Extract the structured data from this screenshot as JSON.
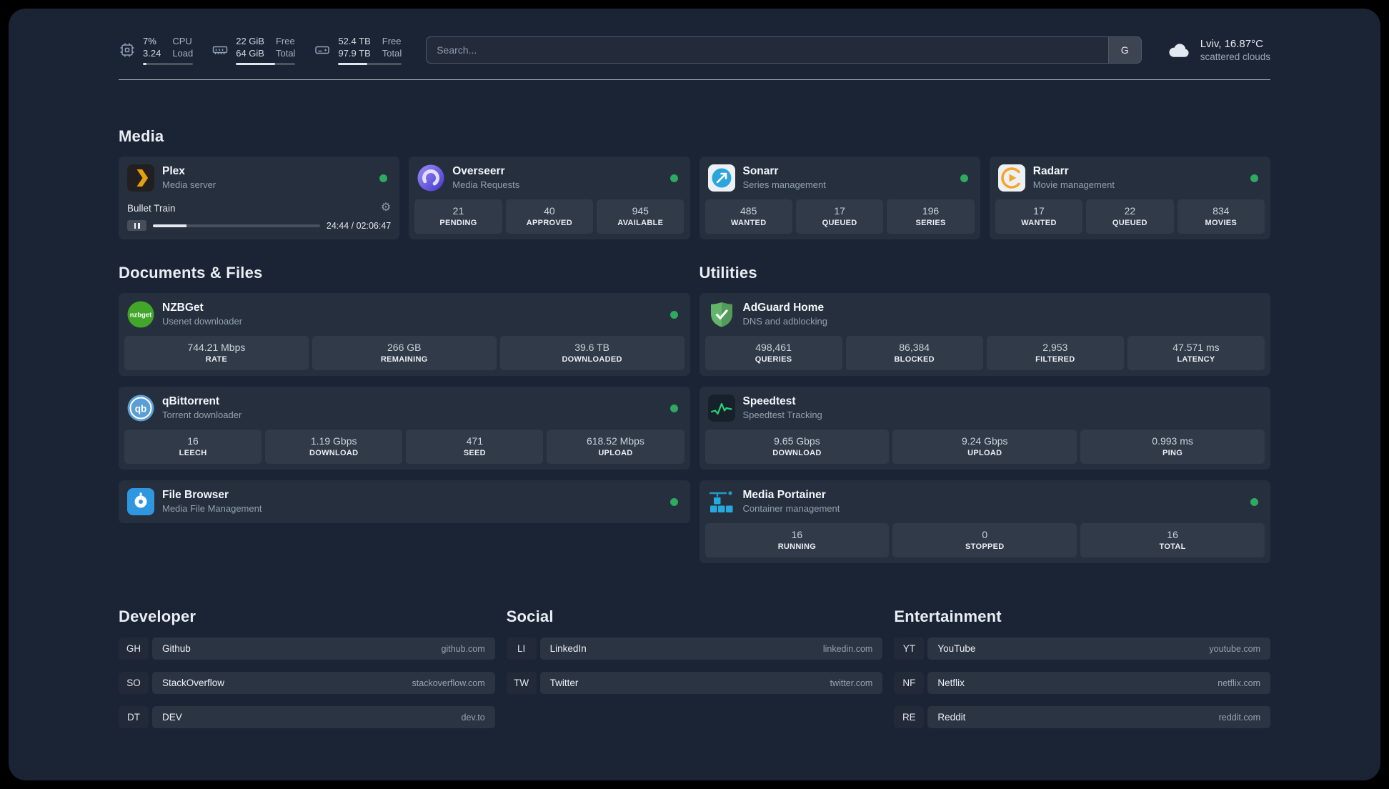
{
  "colors": {
    "background": "#1b2434",
    "status_online": "#2ea95f",
    "plex_accent": "#e5a00d",
    "speedtest_accent": "#2dd36f",
    "progress_fill": "#e2e8f0"
  },
  "topbar": {
    "cpu": {
      "values": [
        "7%",
        "3.24"
      ],
      "labels": [
        "CPU",
        "Load"
      ],
      "used_percent": 7
    },
    "memory": {
      "values": [
        "22 GiB",
        "64 GiB"
      ],
      "labels": [
        "Free",
        "Total"
      ],
      "used_percent": 66
    },
    "disk": {
      "values": [
        "52.4 TB",
        "97.9 TB"
      ],
      "labels": [
        "Free",
        "Total"
      ],
      "used_percent": 46
    },
    "search": {
      "placeholder": "Search...",
      "provider": "G"
    },
    "weather": {
      "location": "Lviv, 16.87°C",
      "condition": "scattered clouds"
    }
  },
  "media": {
    "title": "Media",
    "services": [
      {
        "name": "Plex",
        "description": "Media server",
        "online": true,
        "player": {
          "track": "Bullet Train",
          "time": "24:44 / 02:06:47",
          "progress_percent": 20
        }
      },
      {
        "name": "Overseerr",
        "description": "Media Requests",
        "online": true,
        "stats": [
          {
            "value": "21",
            "label": "PENDING"
          },
          {
            "value": "40",
            "label": "APPROVED"
          },
          {
            "value": "945",
            "label": "AVAILABLE"
          }
        ]
      },
      {
        "name": "Sonarr",
        "description": "Series management",
        "online": true,
        "stats": [
          {
            "value": "485",
            "label": "WANTED"
          },
          {
            "value": "17",
            "label": "QUEUED"
          },
          {
            "value": "196",
            "label": "SERIES"
          }
        ]
      },
      {
        "name": "Radarr",
        "description": "Movie management",
        "online": true,
        "stats": [
          {
            "value": "17",
            "label": "WANTED"
          },
          {
            "value": "22",
            "label": "QUEUED"
          },
          {
            "value": "834",
            "label": "MOVIES"
          }
        ]
      }
    ]
  },
  "documents": {
    "title": "Documents & Files",
    "services": [
      {
        "name": "NZBGet",
        "description": "Usenet downloader",
        "online": true,
        "stats": [
          {
            "value": "744.21 Mbps",
            "label": "RATE"
          },
          {
            "value": "266 GB",
            "label": "REMAINING"
          },
          {
            "value": "39.6 TB",
            "label": "DOWNLOADED"
          }
        ]
      },
      {
        "name": "qBittorrent",
        "description": "Torrent downloader",
        "online": true,
        "stats": [
          {
            "value": "16",
            "label": "LEECH"
          },
          {
            "value": "1.19 Gbps",
            "label": "DOWNLOAD"
          },
          {
            "value": "471",
            "label": "SEED"
          },
          {
            "value": "618.52 Mbps",
            "label": "UPLOAD"
          }
        ]
      },
      {
        "name": "File Browser",
        "description": "Media File Management",
        "online": true
      }
    ]
  },
  "utilities": {
    "title": "Utilities",
    "services": [
      {
        "name": "AdGuard Home",
        "description": "DNS and adblocking",
        "stats": [
          {
            "value": "498,461",
            "label": "QUERIES"
          },
          {
            "value": "86,384",
            "label": "BLOCKED"
          },
          {
            "value": "2,953",
            "label": "FILTERED"
          },
          {
            "value": "47.571 ms",
            "label": "LATENCY"
          }
        ]
      },
      {
        "name": "Speedtest",
        "description": "Speedtest Tracking",
        "stats": [
          {
            "value": "9.65 Gbps",
            "label": "DOWNLOAD"
          },
          {
            "value": "9.24 Gbps",
            "label": "UPLOAD"
          },
          {
            "value": "0.993 ms",
            "label": "PING"
          }
        ]
      },
      {
        "name": "Media Portainer",
        "description": "Container management",
        "online": true,
        "stats": [
          {
            "value": "16",
            "label": "RUNNING"
          },
          {
            "value": "0",
            "label": "STOPPED"
          },
          {
            "value": "16",
            "label": "TOTAL"
          }
        ]
      }
    ]
  },
  "bookmarks": [
    {
      "title": "Developer",
      "items": [
        {
          "abbr": "GH",
          "name": "Github",
          "domain": "github.com"
        },
        {
          "abbr": "SO",
          "name": "StackOverflow",
          "domain": "stackoverflow.com"
        },
        {
          "abbr": "DT",
          "name": "DEV",
          "domain": "dev.to"
        }
      ]
    },
    {
      "title": "Social",
      "items": [
        {
          "abbr": "LI",
          "name": "LinkedIn",
          "domain": "linkedin.com"
        },
        {
          "abbr": "TW",
          "name": "Twitter",
          "domain": "twitter.com"
        }
      ]
    },
    {
      "title": "Entertainment",
      "items": [
        {
          "abbr": "YT",
          "name": "YouTube",
          "domain": "youtube.com"
        },
        {
          "abbr": "NF",
          "name": "Netflix",
          "domain": "netflix.com"
        },
        {
          "abbr": "RE",
          "name": "Reddit",
          "domain": "reddit.com"
        }
      ]
    }
  ]
}
